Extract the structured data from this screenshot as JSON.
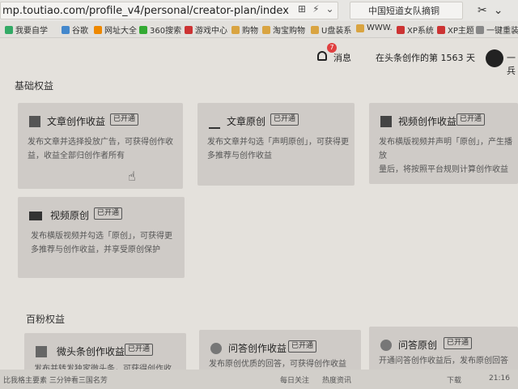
{
  "browser": {
    "url": "mp.toutiao.com/profile_v4/personal/creator-plan/index",
    "search_text": "中国短道女队摘铜",
    "bookmarks": [
      "我要自学",
      "谷歌",
      "网址大全",
      "360搜索",
      "游戏中心",
      "购物",
      "淘宝购物",
      "U盘装系",
      "WWW.",
      "XP系统",
      "XP主题",
      "一键重装"
    ]
  },
  "header": {
    "messages_label": "消息",
    "messages_badge": "7",
    "creation_days": "在头条创作的第 1563 天",
    "user_name_partial": "一兵"
  },
  "sections": {
    "basic_title": "基础权益",
    "fans_title": "百粉权益"
  },
  "basic_cards": [
    {
      "title": "文章创作收益",
      "tag": "已开通",
      "desc_line1": "发布文章并选择投放广告，可获得创作收",
      "desc_line2": "益，收益全部归创作者所有"
    },
    {
      "title": "文章原创",
      "tag": "已开通",
      "desc_line1": "发布文章并勾选「声明原创」，可获得更",
      "desc_line2": "多推荐与创作收益"
    },
    {
      "title": "视频创作收益",
      "tag": "已开通",
      "desc_line1": "发布横版视频并声明「原创」，产生播放",
      "desc_line2": "量后，将按照平台规则计算创作收益"
    },
    {
      "title": "视频原创",
      "tag": "已开通",
      "desc_line1": "发布横版视频并勾选「原创」，可获得更",
      "desc_line2": "多推荐与创作收益，并享受原创保护"
    }
  ],
  "fans_cards": [
    {
      "title": "微头条创作收益",
      "tag": "已开通",
      "desc_line1": "发布并转发独家微头条，可获得创作收"
    },
    {
      "title": "问答创作收益",
      "tag": "已开通",
      "desc_line1": "发布原创优质的回答，可获得创作收益"
    },
    {
      "title": "问答原创",
      "tag": "已开通",
      "desc_line1": "开通问答创作收益后，发布原创回答"
    }
  ],
  "taskbar": {
    "left_text": "比我格主要素  三分钟看三国名芳",
    "items": [
      "每日关注",
      "热度资讯"
    ],
    "download": "下载",
    "time": "21:16"
  },
  "colors": {
    "badge": "#e04040",
    "card_bg": "#cfcbc7",
    "page_bg": "#e4e1dc"
  }
}
